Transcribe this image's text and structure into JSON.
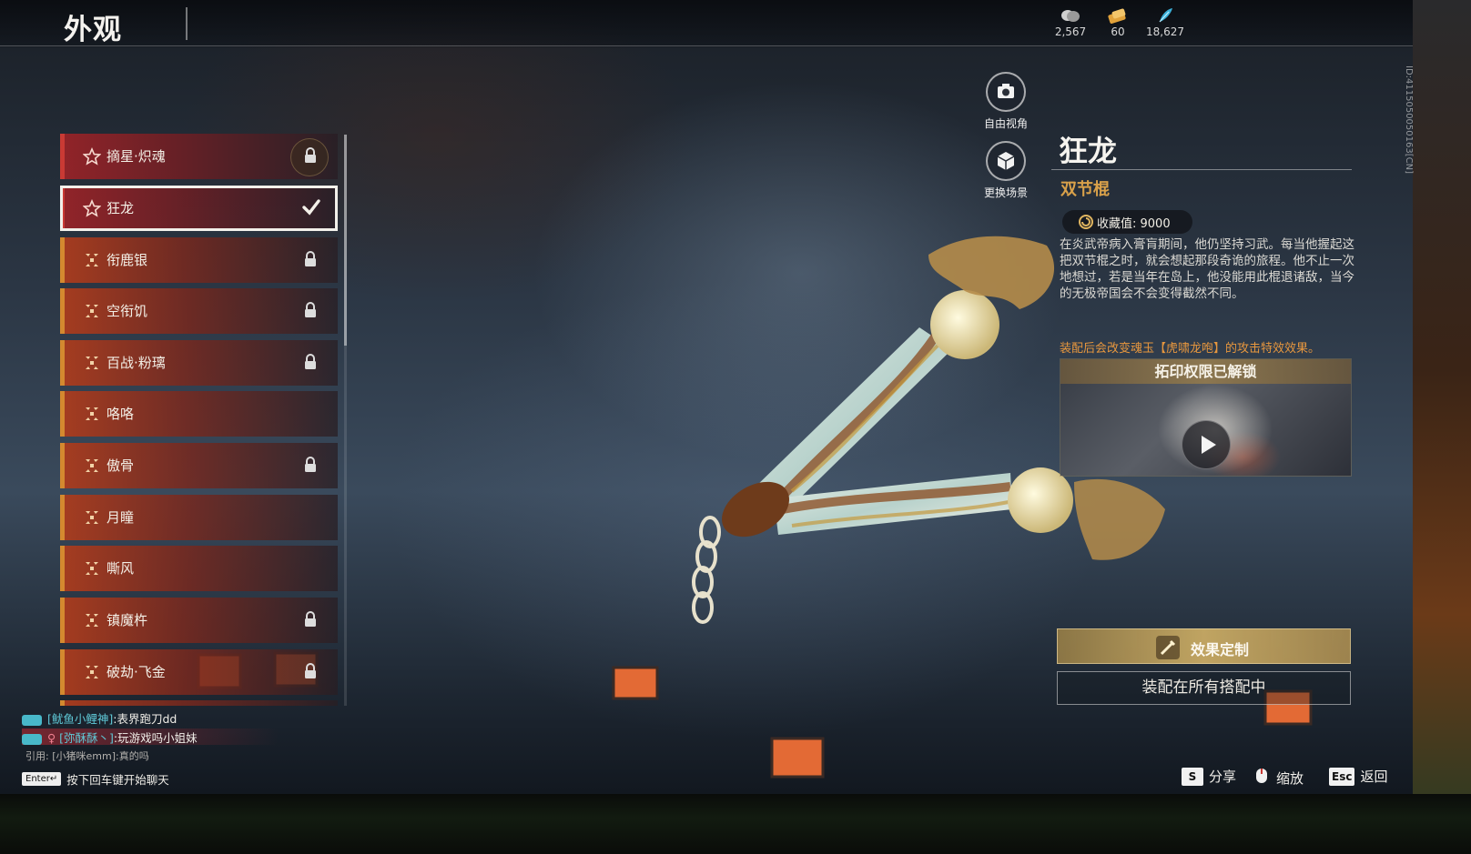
{
  "header": {
    "title": "外观",
    "currencies": [
      {
        "icon": "coin-bag-icon",
        "value": "2,567"
      },
      {
        "icon": "ticket-icon",
        "value": "60"
      },
      {
        "icon": "feather-icon",
        "value": "18,627"
      }
    ]
  },
  "skin_list": [
    {
      "name": "摘星·炽魂",
      "rarity": "red",
      "locked": true,
      "selected": false
    },
    {
      "name": "狂龙",
      "rarity": "red",
      "locked": false,
      "selected": true
    },
    {
      "name": "衔鹿银",
      "rarity": "gold",
      "locked": true,
      "selected": false
    },
    {
      "name": "空衔饥",
      "rarity": "gold",
      "locked": true,
      "selected": false
    },
    {
      "name": "百战·粉璃",
      "rarity": "gold",
      "locked": true,
      "selected": false
    },
    {
      "name": "咯咯",
      "rarity": "gold",
      "locked": false,
      "selected": false
    },
    {
      "name": "傲骨",
      "rarity": "gold",
      "locked": true,
      "selected": false
    },
    {
      "name": "月瞳",
      "rarity": "gold",
      "locked": false,
      "selected": false
    },
    {
      "name": "嘶风",
      "rarity": "gold",
      "locked": false,
      "selected": false
    },
    {
      "name": "镇魔杵",
      "rarity": "gold",
      "locked": true,
      "selected": false
    },
    {
      "name": "破劫·飞金",
      "rarity": "gold",
      "locked": true,
      "selected": false
    }
  ],
  "camera_controls": {
    "free_view": "自由视角",
    "change_scene": "更换场景"
  },
  "detail": {
    "name": "狂龙",
    "type": "双节棍",
    "collection_label": "收藏值: 9000",
    "description": "在炎武帝病入膏肓期间，他仍坚持习武。每当他握起这把双节棍之时，就会想起那段奇诡的旅程。他不止一次地想过，若是当年在岛上，他没能用此棍退诸敌，当今的无极帝国会不会变得截然不同。",
    "effect_note": "装配后会改变魂玉【虎啸龙咆】的攻击特效效果。",
    "preview_title": "拓印权限已解锁",
    "effect_button": "效果定制",
    "equip_button": "装配在所有搭配中"
  },
  "uid": "ID:4115050050163[CN]",
  "chat": {
    "lines": [
      {
        "name": "[鱿鱼小鲤神]",
        "text": ":表界跑刀dd"
      },
      {
        "name": "[弥酥酥丶]",
        "text": ":玩游戏吗小姐妹"
      }
    ],
    "quote": "引用: [小猪咪emm]:真的吗",
    "enter_key": "Enter↵",
    "hint": "按下回车键开始聊天"
  },
  "bottom_actions": [
    {
      "key": "S",
      "label": "分享"
    },
    {
      "key": "",
      "label": "缩放"
    },
    {
      "key": "Esc",
      "label": "返回"
    }
  ],
  "colors": {
    "accent_gold": "#d9a14a",
    "effect_orange": "#e7973e",
    "rarity_red": "#c93a34",
    "rarity_gold": "#d4892f",
    "chat_cyan": "#5fc8d6"
  }
}
